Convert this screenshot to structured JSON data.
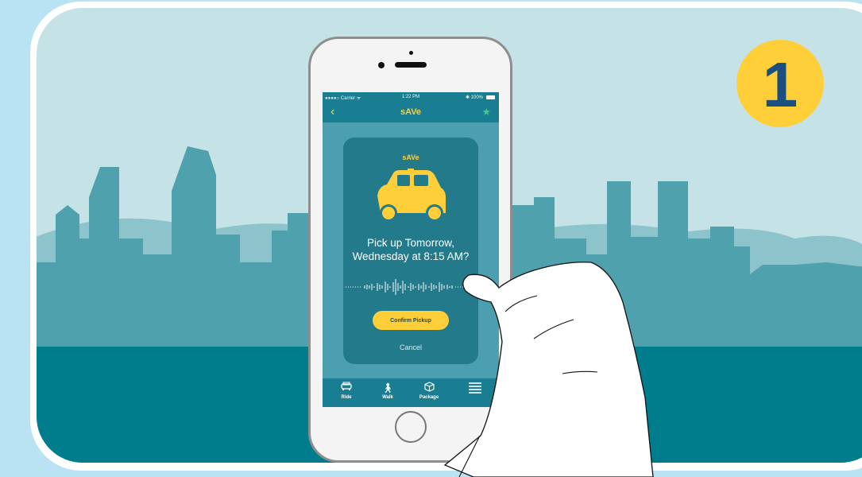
{
  "step": {
    "number": "1"
  },
  "status_bar": {
    "carrier": "●●●●○ Carrier ᯤ",
    "time": "1:22 PM",
    "battery": "✱ 100%"
  },
  "nav": {
    "title": "sAVe"
  },
  "card": {
    "title": "sAVe",
    "question_line1": "Pick up Tomorrow,",
    "question_line2": "Wednesday at 8:15 AM?",
    "confirm_label": "Confirm Pickup",
    "cancel_label": "Cancel"
  },
  "tabs": [
    {
      "label": "Ride",
      "icon": "car-icon"
    },
    {
      "label": "Walk",
      "icon": "walk-icon"
    },
    {
      "label": "Package",
      "icon": "package-icon"
    },
    {
      "label": "",
      "icon": "menu-icon"
    }
  ],
  "colors": {
    "sky": "#c5e3e7",
    "skyline": "#4fa1ae",
    "water": "#007d8d",
    "accent_yellow": "#ffcf3a",
    "phone_bar": "#1a7e93",
    "card": "#237a8b"
  }
}
